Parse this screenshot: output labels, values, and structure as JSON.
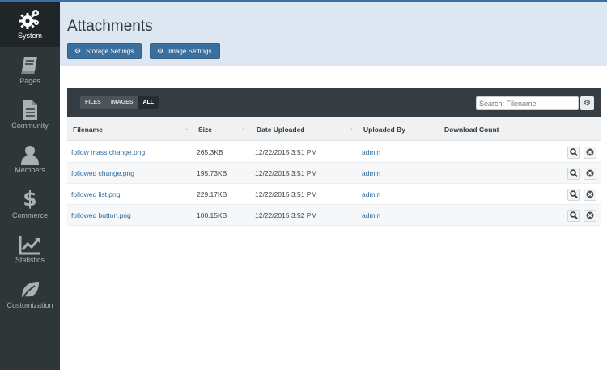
{
  "sidebar": {
    "items": [
      {
        "label": "System",
        "icon": "gears-icon",
        "active": true
      },
      {
        "label": "Pages",
        "icon": "book-icon"
      },
      {
        "label": "Community",
        "icon": "document-icon"
      },
      {
        "label": "Members",
        "icon": "user-icon"
      },
      {
        "label": "Commerce",
        "icon": "dollar-icon"
      },
      {
        "label": "Statistics",
        "icon": "chart-icon"
      },
      {
        "label": "Customization",
        "icon": "leaf-icon"
      }
    ]
  },
  "header": {
    "title": "Attachments",
    "storage_button": "Storage Settings",
    "image_button": "Image Settings"
  },
  "filters": {
    "files": "FILES",
    "images": "IMAGES",
    "all": "ALL",
    "active": "ALL"
  },
  "search": {
    "placeholder": "Search: Filename"
  },
  "table": {
    "columns": [
      "Filename",
      "Size",
      "Date Uploaded",
      "Uploaded By",
      "Download Count"
    ],
    "rows": [
      {
        "filename": "follow mass change.png",
        "size": "265.3KB",
        "date": "12/22/2015 3:51 PM",
        "uploader": "admin",
        "downloads": ""
      },
      {
        "filename": "followed change.png",
        "size": "195.73KB",
        "date": "12/22/2015 3:51 PM",
        "uploader": "admin",
        "downloads": ""
      },
      {
        "filename": "followed list.png",
        "size": "229.17KB",
        "date": "12/22/2015 3:51 PM",
        "uploader": "admin",
        "downloads": ""
      },
      {
        "filename": "followed button.png",
        "size": "100.15KB",
        "date": "12/22/2015 3:52 PM",
        "uploader": "admin",
        "downloads": ""
      }
    ]
  },
  "colors": {
    "sidebar": "#2f3638",
    "header": "#dde7f1",
    "accent": "#3b6f9e",
    "link": "#2c6aa0"
  }
}
